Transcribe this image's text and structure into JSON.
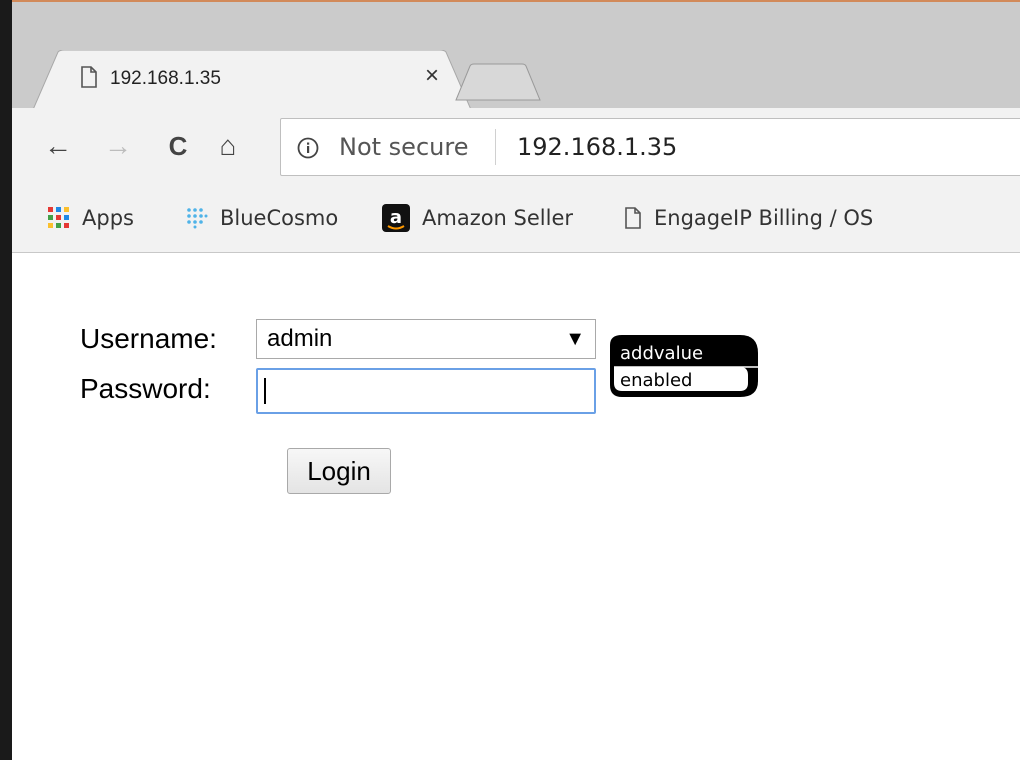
{
  "tab": {
    "title": "192.168.1.35",
    "close_glyph": "×"
  },
  "toolbar": {
    "back_glyph": "←",
    "forward_glyph": "→",
    "reload_glyph": "C",
    "home_glyph": "⌂",
    "security_text": "Not secure",
    "url": "192.168.1.35"
  },
  "bookmarks": [
    {
      "icon": "apps-grid-icon",
      "label": "Apps"
    },
    {
      "icon": "bluecosmo-icon",
      "label": "BlueCosmo"
    },
    {
      "icon": "amazon-icon",
      "label": "Amazon Seller"
    },
    {
      "icon": "page-icon",
      "label": "EngageIP Billing / OS"
    }
  ],
  "form": {
    "username_label": "Username:",
    "username_value": "admin",
    "password_label": "Password:",
    "password_value": "",
    "login_label": "Login"
  },
  "logo": {
    "line1": "addvalue",
    "line2": "enabled"
  },
  "colors": {
    "focus_border": "#6aa0e6",
    "tabstrip": "#cbcbcb",
    "toolbar": "#f2f2f2"
  }
}
